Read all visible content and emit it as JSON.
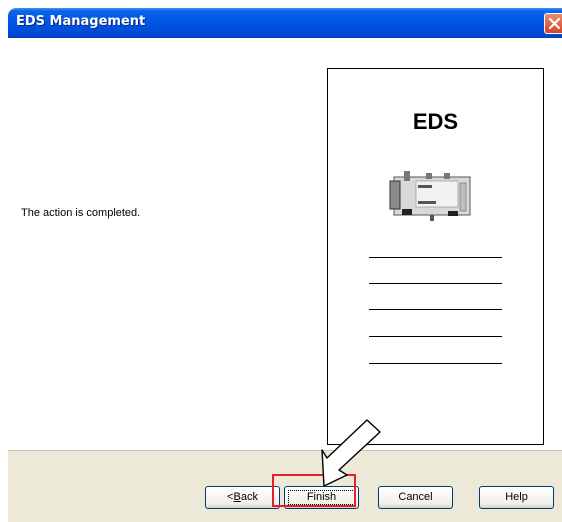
{
  "window": {
    "title": "EDS Management"
  },
  "content": {
    "message": "The action is completed."
  },
  "illustration": {
    "heading": "EDS"
  },
  "buttons": {
    "back_prefix": "< ",
    "back_mnemonic": "B",
    "back_rest": "ack",
    "finish": "Finish",
    "cancel": "Cancel",
    "help": "Help"
  },
  "icons": {
    "close": "close-icon",
    "device": "network-module-icon",
    "pointer": "arrow-pointer-icon"
  },
  "colors": {
    "titlebar": "#0055e5",
    "close": "#d4432a",
    "footer": "#ece9d8",
    "highlight": "#e8202a"
  }
}
